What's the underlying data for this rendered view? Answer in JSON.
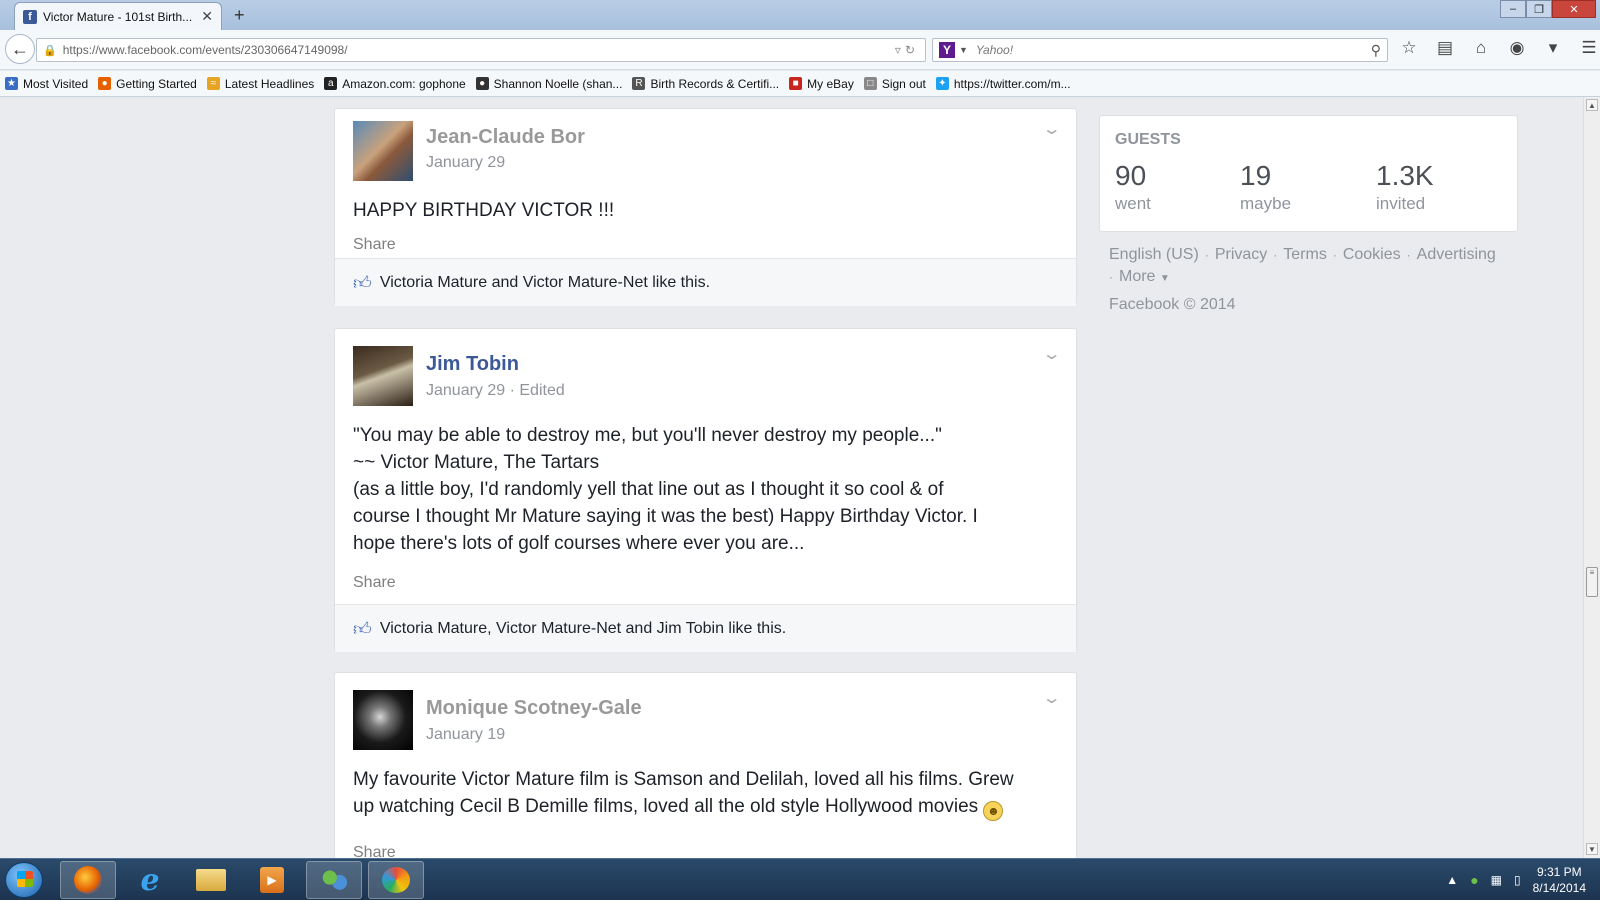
{
  "browser": {
    "tab_title": "Victor Mature - 101st Birth...",
    "tab_close": "✕",
    "new_tab": "+",
    "url": "https://www.facebook.com/events/230306647149098/",
    "search_placeholder": "Yahoo!",
    "bookmarks": [
      {
        "label": "Most Visited",
        "icon": "most-visited-icon",
        "color": "#3a6cc6"
      },
      {
        "label": "Getting Started",
        "icon": "firefox-icon",
        "color": "#e66000"
      },
      {
        "label": "Latest Headlines",
        "icon": "rss-icon",
        "color": "#e8a423"
      },
      {
        "label": "Amazon.com: gophone",
        "icon": "amazon-icon",
        "color": "#222222"
      },
      {
        "label": "Shannon Noelle (shan...",
        "icon": "people-icon",
        "color": "#333333"
      },
      {
        "label": "Birth Records & Certifi...",
        "icon": "rb-icon",
        "color": "#555555"
      },
      {
        "label": "My eBay",
        "icon": "ebay-icon",
        "color": "#c7261e"
      },
      {
        "label": "Sign out",
        "icon": "page-icon",
        "color": "#888888"
      },
      {
        "label": "https://twitter.com/m...",
        "icon": "twitter-icon",
        "color": "#1da1f2"
      }
    ]
  },
  "posts": [
    {
      "author": "Jean-Claude Bor",
      "meta": "January 29",
      "body": "HAPPY BIRTHDAY VICTOR !!!",
      "share": "Share",
      "likes": "Victoria Mature and Victor Mature-Net like this."
    },
    {
      "author": "Jim Tobin",
      "meta": "January 29 · Edited",
      "body_lines": [
        "\"You may be able to destroy me, but you'll never destroy my people...\"",
        "~~ Victor Mature, The Tartars",
        "(as a little boy, I'd randomly yell that line out as I thought it so cool & of",
        "course I thought Mr Mature saying it was the best) Happy Birthday Victor. I",
        "hope there's lots of golf courses where ever you are..."
      ],
      "share": "Share",
      "likes": "Victoria Mature, Victor Mature-Net and Jim Tobin like this."
    },
    {
      "author": "Monique Scotney-Gale",
      "meta": "January 19",
      "body_lines": [
        "My favourite Victor Mature film is Samson and Delilah, loved all his films. Grew",
        "up watching Cecil B Demille films, loved all the old style Hollywood movies"
      ],
      "share": "Share"
    }
  ],
  "guests": {
    "title": "GUESTS",
    "went_count": "90",
    "went_label": "went",
    "maybe_count": "19",
    "maybe_label": "maybe",
    "invited_count": "1.3K",
    "invited_label": "invited"
  },
  "footer": {
    "links": [
      "English (US)",
      "Privacy",
      "Terms",
      "Cookies",
      "Advertising"
    ],
    "more": "More",
    "copyright": "Facebook © 2014"
  },
  "taskbar": {
    "time": "9:31 PM",
    "date": "8/14/2014"
  },
  "colors": {
    "facebook_blue": "#3b5998",
    "link_blue": "#4267b2",
    "gray_text": "#90949c"
  }
}
